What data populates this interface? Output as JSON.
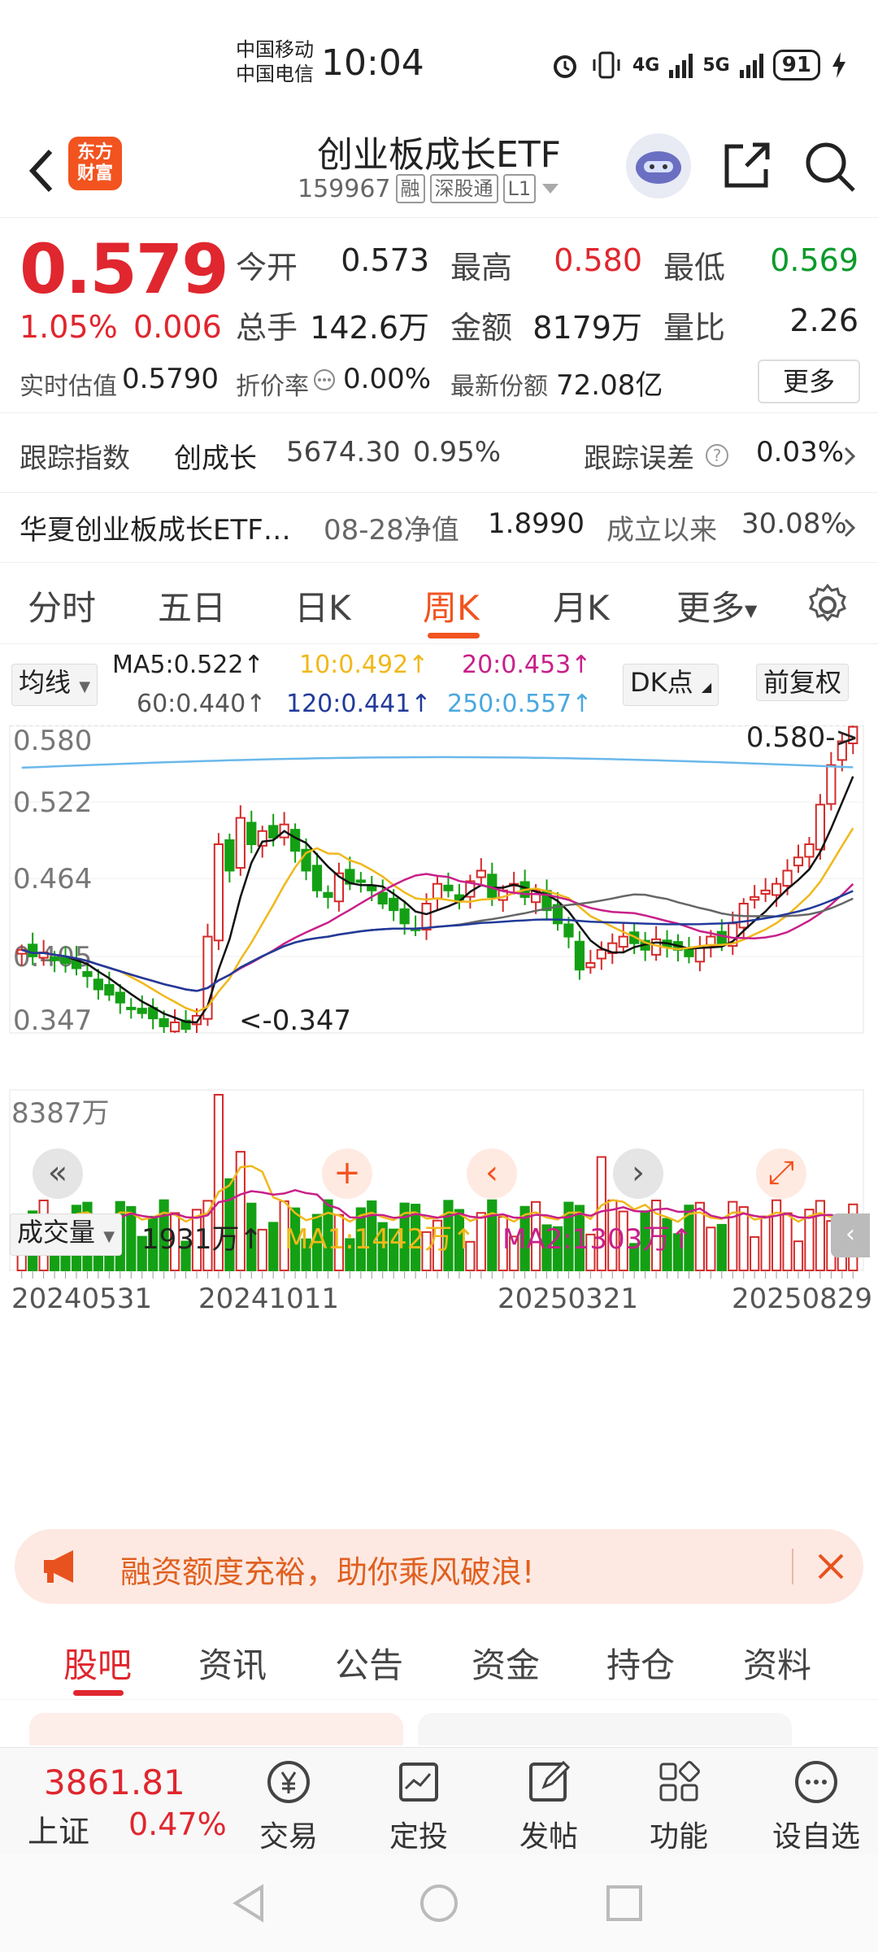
{
  "status": {
    "carrier1": "中国移动",
    "carrier2": "中国电信",
    "time": "10:04",
    "net1": "4G",
    "net2": "5G",
    "battery": "91"
  },
  "header": {
    "logo_line1": "东方",
    "logo_line2": "财富",
    "title": "创业板成长ETF",
    "code": "159967",
    "tags": [
      "融",
      "深股通",
      "L1"
    ]
  },
  "quote": {
    "price": "0.579",
    "change_pct": "1.05%",
    "change": "0.006",
    "open_label": "今开",
    "open": "0.573",
    "high_label": "最高",
    "high": "0.580",
    "low_label": "最低",
    "low": "0.569",
    "vol_label": "总手",
    "vol": "142.6万",
    "amt_label": "金额",
    "amt": "8179万",
    "ratio_label": "量比",
    "ratio": "2.26",
    "est_label": "实时估值",
    "est": "0.5790",
    "disc_label": "折价率",
    "disc": "0.00%",
    "share_label": "最新份额",
    "share": "72.08亿",
    "more": "更多"
  },
  "tracking": {
    "label": "跟踪指数",
    "index": "创成长",
    "value": "5674.30",
    "pct": "0.95%",
    "err_label": "跟踪误差",
    "err": "0.03%"
  },
  "fund": {
    "name": "华夏创业板成长ETF…",
    "nav_label": "08-28净值",
    "nav": "1.8990",
    "since_label": "成立以来",
    "since": "30.08%"
  },
  "tabs": [
    "分时",
    "五日",
    "日K",
    "周K",
    "月K",
    "更多"
  ],
  "chart": {
    "ma_select": "均线",
    "dk": "DK点",
    "adj": "前复权",
    "ma5": "MA5:0.522↑",
    "ma10": "10:0.492↑",
    "ma20": "20:0.453↑",
    "ma60": "60:0.440↑",
    "ma120": "120:0.441↑",
    "ma250": "250:0.557↑",
    "y_labels": [
      "0.580",
      "0.522",
      "0.464",
      "0.405",
      "0.347"
    ],
    "max_mark": "0.580->",
    "min_mark": "<-0.347",
    "vol_select": "成交量",
    "vol_val": "1931万↑",
    "vol_ma1": "MA1:1442万↑",
    "vol_ma2": "MA2:1303万↑",
    "vol_max": "8387万",
    "dates": [
      "20240531",
      "20241011",
      "20250321",
      "20250829"
    ],
    "colors": {
      "ma5": "#111111",
      "ma10": "#f0b81a",
      "ma20": "#c8208a",
      "ma60": "#666666",
      "ma120": "#223a9a",
      "ma250": "#6ab8ea",
      "up": "#d42a2a",
      "down": "#14a014"
    }
  },
  "chart_data": {
    "type": "candlestick",
    "period": "weekly",
    "ylim": [
      0.347,
      0.58
    ],
    "x_ticks": [
      "20240531",
      "20241011",
      "20250321",
      "20250829"
    ],
    "last_close": 0.579,
    "period_high": 0.58,
    "period_low": 0.347,
    "ma_lines": [
      {
        "name": "MA5",
        "value": 0.522
      },
      {
        "name": "10",
        "value": 0.492
      },
      {
        "name": "20",
        "value": 0.453
      },
      {
        "name": "60",
        "value": 0.44
      },
      {
        "name": "120",
        "value": 0.441
      },
      {
        "name": "250",
        "value": 0.557
      }
    ],
    "closes": [
      0.41,
      0.405,
      0.408,
      0.402,
      0.4,
      0.396,
      0.39,
      0.38,
      0.376,
      0.37,
      0.366,
      0.362,
      0.358,
      0.352,
      0.355,
      0.35,
      0.36,
      0.42,
      0.49,
      0.47,
      0.51,
      0.49,
      0.5,
      0.495,
      0.505,
      0.485,
      0.47,
      0.455,
      0.45,
      0.468,
      0.46,
      0.462,
      0.455,
      0.445,
      0.44,
      0.43,
      0.425,
      0.445,
      0.46,
      0.455,
      0.448,
      0.462,
      0.47,
      0.45,
      0.455,
      0.46,
      0.45,
      0.455,
      0.44,
      0.43,
      0.42,
      0.395,
      0.4,
      0.41,
      0.415,
      0.42,
      0.415,
      0.41,
      0.418,
      0.412,
      0.41,
      0.405,
      0.412,
      0.42,
      0.415,
      0.43,
      0.445,
      0.45,
      0.455,
      0.46,
      0.47,
      0.48,
      0.49,
      0.52,
      0.55,
      0.568,
      0.579
    ],
    "volume_max": "8387万",
    "volume_last": "1931万"
  },
  "banner": {
    "text": "融资额度充裕，助你乘风破浪!"
  },
  "subtabs": [
    "股吧",
    "资讯",
    "公告",
    "资金",
    "持仓",
    "资料"
  ],
  "bottom": {
    "index_value": "3861.81",
    "index_name": "上证",
    "index_pct": "0.47%",
    "items": [
      "交易",
      "定投",
      "发帖",
      "功能",
      "设自选"
    ]
  }
}
